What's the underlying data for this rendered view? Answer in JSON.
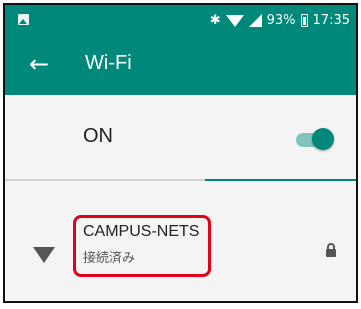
{
  "status_bar": {
    "battery_text": "93%",
    "time": "17:35",
    "bluetooth_glyph": "✱",
    "icons": [
      "gallery-icon",
      "bluetooth-icon",
      "wifi-signal-icon",
      "cell-signal-icon",
      "battery-icon"
    ]
  },
  "app_bar": {
    "back_glyph": "←",
    "title": "Wi-Fi"
  },
  "toggle": {
    "label": "ON",
    "state": "on"
  },
  "networks": [
    {
      "ssid": "CAMPUS-NETS",
      "status": "接続済み",
      "secured": true,
      "icon": "wifi-icon"
    }
  ],
  "colors": {
    "primary": "#00887a",
    "switch_track": "#7fc5bd",
    "highlight": "#e0001b",
    "background": "#f4f4f4"
  }
}
